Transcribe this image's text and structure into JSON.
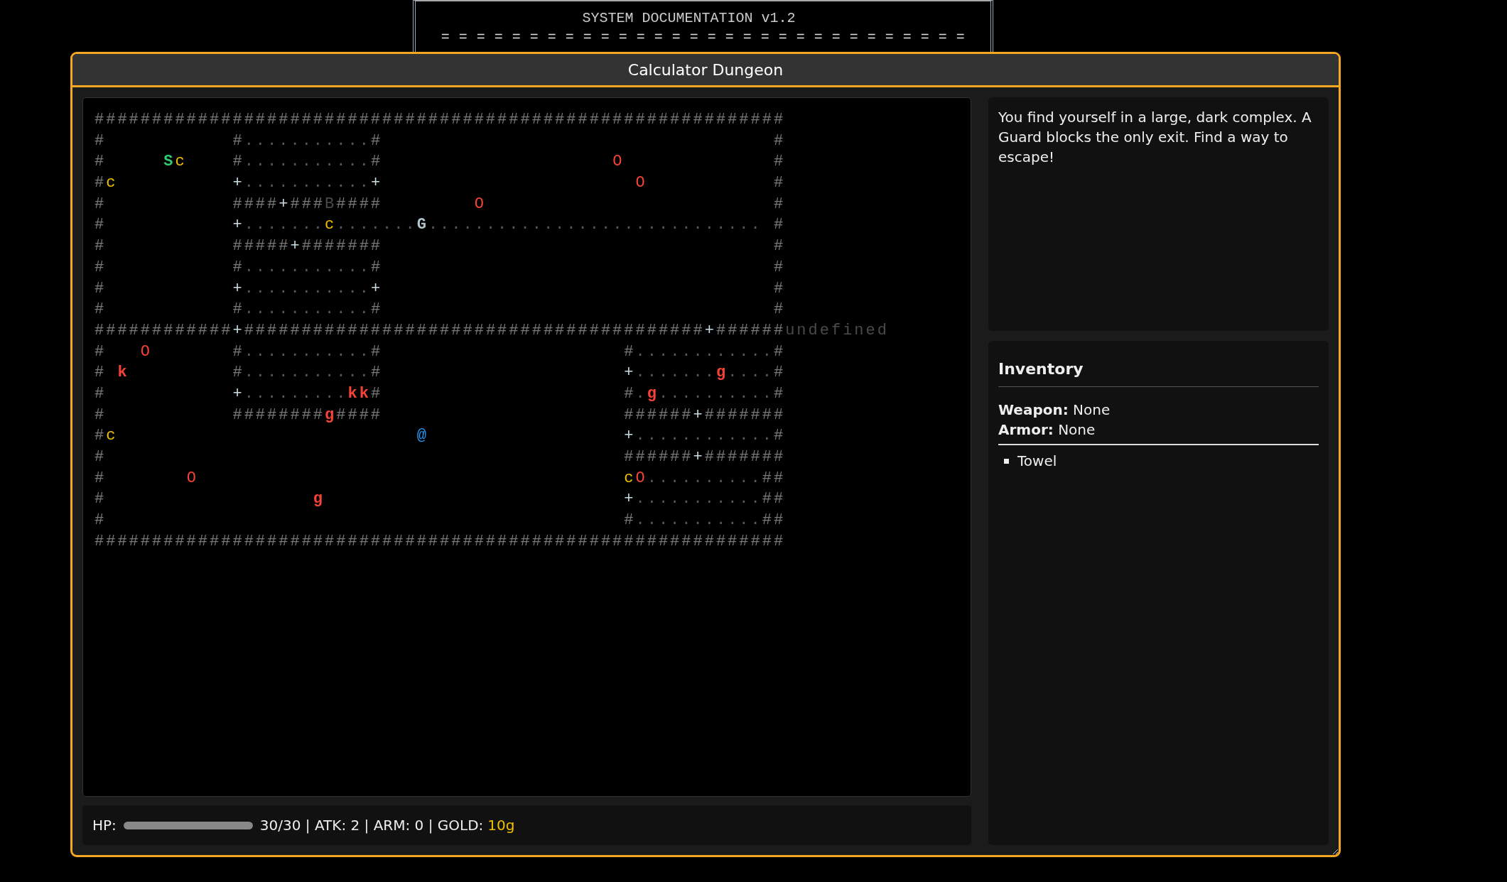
{
  "doc_header": {
    "title": "SYSTEM DOCUMENTATION v1.2",
    "rule": "= = = = = = = = = = = = = = = = = = = = = = = = = = = = = ="
  },
  "window": {
    "title": "Calculator Dungeon"
  },
  "map": {
    "rows": [
      {
        "runs": [
          {
            "kind": "wall",
            "text": "############################################################"
          }
        ]
      },
      {
        "runs": [
          {
            "kind": "wall",
            "text": "#           #"
          },
          {
            "kind": "floor",
            "text": "..........."
          },
          {
            "kind": "wall",
            "text": "#                                  #"
          }
        ]
      },
      {
        "runs": [
          {
            "kind": "wall",
            "text": "#     "
          },
          {
            "kind": "mark",
            "text": "S",
            "color": "#2ecc71",
            "bold": true
          },
          {
            "kind": "mark",
            "text": "c    ",
            "color": "#f0c000",
            "bold": false
          },
          {
            "kind": "wall",
            "text": "#"
          },
          {
            "kind": "floor",
            "text": "..........."
          },
          {
            "kind": "wall",
            "text": "#                    "
          },
          {
            "kind": "mark",
            "text": "O             ",
            "color": "#f44336",
            "bold": false
          },
          {
            "kind": "wall",
            "text": "#"
          }
        ]
      },
      {
        "runs": [
          {
            "kind": "wall",
            "text": "#"
          },
          {
            "kind": "mark",
            "text": "c          ",
            "color": "#f0c000",
            "bold": false
          },
          {
            "kind": "door",
            "text": "+"
          },
          {
            "kind": "floor",
            "text": "..........."
          },
          {
            "kind": "door",
            "text": "+                      "
          },
          {
            "kind": "mark",
            "text": "O           ",
            "color": "#f44336",
            "bold": false
          },
          {
            "kind": "wall",
            "text": "#"
          }
        ]
      },
      {
        "runs": [
          {
            "kind": "wall",
            "text": "#           ####"
          },
          {
            "kind": "door",
            "text": "+"
          },
          {
            "kind": "wall",
            "text": "###"
          },
          {
            "kind": "faded",
            "text": "B"
          },
          {
            "kind": "wall",
            "text": "####        "
          },
          {
            "kind": "mark",
            "text": "O                         ",
            "color": "#f44336",
            "bold": false
          },
          {
            "kind": "wall",
            "text": "#"
          }
        ]
      },
      {
        "runs": [
          {
            "kind": "wall",
            "text": "#           "
          },
          {
            "kind": "door",
            "text": "+"
          },
          {
            "kind": "floor",
            "text": "......."
          },
          {
            "kind": "mark",
            "text": "c",
            "color": "#f0c000",
            "bold": false
          },
          {
            "kind": "floor",
            "text": "......."
          },
          {
            "kind": "mark",
            "text": "G",
            "color": "#b0c4cc",
            "bold": true
          },
          {
            "kind": "floor",
            "text": "............................. "
          },
          {
            "kind": "wall",
            "text": "#"
          }
        ]
      },
      {
        "runs": [
          {
            "kind": "wall",
            "text": "#           #####"
          },
          {
            "kind": "door",
            "text": "+"
          },
          {
            "kind": "wall",
            "text": "#######                                  #"
          }
        ]
      },
      {
        "runs": [
          {
            "kind": "wall",
            "text": "#           #"
          },
          {
            "kind": "floor",
            "text": "..........."
          },
          {
            "kind": "wall",
            "text": "#                                  #"
          }
        ]
      },
      {
        "runs": [
          {
            "kind": "wall",
            "text": "#           "
          },
          {
            "kind": "door",
            "text": "+"
          },
          {
            "kind": "floor",
            "text": "..........."
          },
          {
            "kind": "door",
            "text": "+                                  "
          },
          {
            "kind": "wall",
            "text": "#"
          }
        ]
      },
      {
        "runs": [
          {
            "kind": "wall",
            "text": "#           #"
          },
          {
            "kind": "floor",
            "text": "..........."
          },
          {
            "kind": "wall",
            "text": "#                                  #"
          }
        ]
      },
      {
        "runs": [
          {
            "kind": "wall",
            "text": "############"
          },
          {
            "kind": "door",
            "text": "+"
          },
          {
            "kind": "wall",
            "text": "########################################"
          },
          {
            "kind": "door",
            "text": "+"
          },
          {
            "kind": "wall",
            "text": "######"
          },
          {
            "kind": "faded",
            "text": "undefined"
          }
        ]
      },
      {
        "runs": [
          {
            "kind": "wall",
            "text": "#   "
          },
          {
            "kind": "mark",
            "text": "O       ",
            "color": "#f44336",
            "bold": false
          },
          {
            "kind": "wall",
            "text": "#"
          },
          {
            "kind": "floor",
            "text": "..........."
          },
          {
            "kind": "wall",
            "text": "#                     #"
          },
          {
            "kind": "floor",
            "text": "............"
          },
          {
            "kind": "wall",
            "text": "#"
          }
        ]
      },
      {
        "runs": [
          {
            "kind": "wall",
            "text": "# "
          },
          {
            "kind": "mark",
            "text": "k         ",
            "color": "#f44336",
            "bold": true
          },
          {
            "kind": "wall",
            "text": "#"
          },
          {
            "kind": "floor",
            "text": "..........."
          },
          {
            "kind": "wall",
            "text": "#                     "
          },
          {
            "kind": "door",
            "text": "+"
          },
          {
            "kind": "floor",
            "text": "......."
          },
          {
            "kind": "mark",
            "text": "g",
            "color": "#f44336",
            "bold": true
          },
          {
            "kind": "floor",
            "text": "...."
          },
          {
            "kind": "wall",
            "text": "#"
          }
        ]
      },
      {
        "runs": [
          {
            "kind": "wall",
            "text": "#           "
          },
          {
            "kind": "door",
            "text": "+"
          },
          {
            "kind": "floor",
            "text": "........."
          },
          {
            "kind": "mark",
            "text": "kk",
            "color": "#f44336",
            "bold": true
          },
          {
            "kind": "wall",
            "text": "#                     #"
          },
          {
            "kind": "floor",
            "text": "."
          },
          {
            "kind": "mark",
            "text": "g",
            "color": "#f44336",
            "bold": true
          },
          {
            "kind": "floor",
            "text": ".........."
          },
          {
            "kind": "wall",
            "text": "#"
          }
        ]
      },
      {
        "runs": [
          {
            "kind": "wall",
            "text": "#           ########"
          },
          {
            "kind": "mark",
            "text": "g",
            "color": "#f44336",
            "bold": true
          },
          {
            "kind": "wall",
            "text": "####                     ######"
          },
          {
            "kind": "door",
            "text": "+"
          },
          {
            "kind": "wall",
            "text": "#######"
          }
        ]
      },
      {
        "runs": [
          {
            "kind": "wall",
            "text": "#"
          },
          {
            "kind": "mark",
            "text": "c                          ",
            "color": "#f0c000",
            "bold": false
          },
          {
            "kind": "mark",
            "text": "@                 ",
            "color": "#2196f3",
            "bold": false
          },
          {
            "kind": "door",
            "text": "+"
          },
          {
            "kind": "floor",
            "text": "............"
          },
          {
            "kind": "wall",
            "text": "#"
          }
        ]
      },
      {
        "runs": [
          {
            "kind": "wall",
            "text": "#                                             ######"
          },
          {
            "kind": "door",
            "text": "+"
          },
          {
            "kind": "wall",
            "text": "#######"
          }
        ]
      },
      {
        "runs": [
          {
            "kind": "wall",
            "text": "#       "
          },
          {
            "kind": "mark",
            "text": "O                                     ",
            "color": "#f44336",
            "bold": false
          },
          {
            "kind": "mark",
            "text": "c",
            "color": "#f0c000",
            "bold": false
          },
          {
            "kind": "mark",
            "text": "O",
            "color": "#f44336",
            "bold": false
          },
          {
            "kind": "floor",
            "text": ".........."
          },
          {
            "kind": "wall",
            "text": "##"
          }
        ]
      },
      {
        "runs": [
          {
            "kind": "wall",
            "text": "#                  "
          },
          {
            "kind": "mark",
            "text": "g                          ",
            "color": "#f44336",
            "bold": true
          },
          {
            "kind": "door",
            "text": "+"
          },
          {
            "kind": "floor",
            "text": "..........."
          },
          {
            "kind": "wall",
            "text": "##"
          }
        ]
      },
      {
        "runs": [
          {
            "kind": "wall",
            "text": "#                                             #"
          },
          {
            "kind": "floor",
            "text": "..........."
          },
          {
            "kind": "wall",
            "text": "##"
          }
        ]
      },
      {
        "runs": [
          {
            "kind": "wall",
            "text": "############################################################"
          }
        ]
      }
    ]
  },
  "status_bar": {
    "hp_label": "HP:",
    "hp": {
      "level": 1
    },
    "stats": "30/30 | ATK: 2 | ARM: 0 | GOLD:",
    "gold": "10g"
  },
  "message": "You find yourself in a large, dark complex. A Guard blocks the only exit. Find a way to escape!",
  "inventory": {
    "title": "Inventory",
    "equipment": [
      "**Weapon:** None",
      "**Armor:** None"
    ],
    "items": [
      "Towel"
    ]
  }
}
